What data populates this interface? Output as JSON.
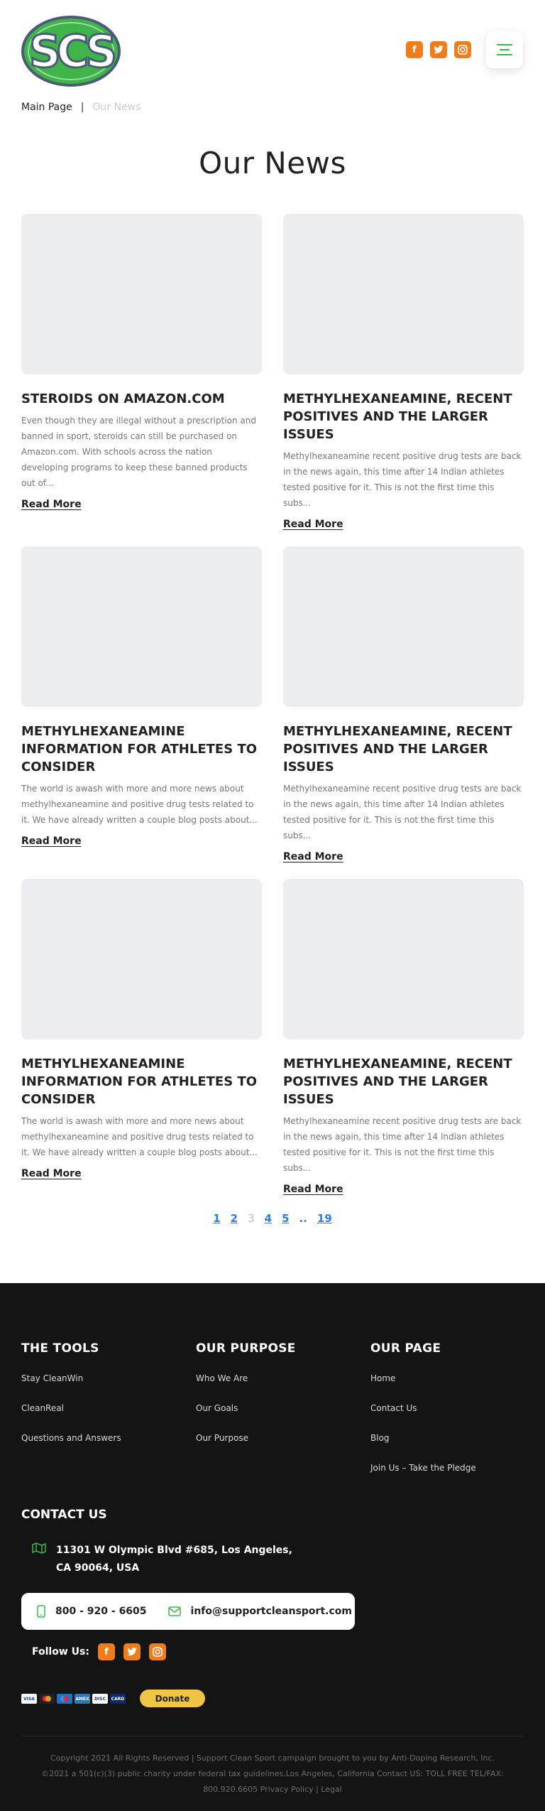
{
  "header": {
    "logo_text": "SCS",
    "social": [
      {
        "icon": "facebook-icon",
        "glyph": "f"
      },
      {
        "icon": "twitter-icon",
        "glyph": "t"
      },
      {
        "icon": "instagram-icon",
        "glyph": "◎"
      }
    ],
    "menu_icon": "hamburger-icon"
  },
  "breadcrumb": {
    "home": "Main Page",
    "separator": "|",
    "current": "Our News"
  },
  "page_title": "Our News",
  "read_more_label": "Read More",
  "posts": [
    {
      "title": "STEROIDS ON AMAZON.COM",
      "excerpt": "Even though they are illegal without a prescription and banned in sport, steroids can still be purchased on Amazon.com. With schools across the nation developing programs to keep these banned products out of..."
    },
    {
      "title": "METHYLHEXANEAMINE, RECENT POSITIVES AND THE LARGER ISSUES",
      "excerpt": "Methylhexaneamine recent positive drug tests are back in the news again, this time after 14 Indian athletes tested positive for it. This is not the first time this subs..."
    },
    {
      "title": "METHYLHEXANEAMINE INFORMATION FOR ATHLETES TO CONSIDER",
      "excerpt": "The world is awash with more and more news about methylhexaneamine and positive drug tests related to it.  We have already written a couple blog posts about..."
    },
    {
      "title": "METHYLHEXANEAMINE, RECENT POSITIVES AND THE LARGER ISSUES",
      "excerpt": "Methylhexaneamine recent positive drug tests are back in the news again, this time after 14 Indian athletes tested positive for it. This is not the first time this subs..."
    },
    {
      "title": "METHYLHEXANEAMINE INFORMATION FOR ATHLETES TO CONSIDER",
      "excerpt": "The world is awash with more and more news about methylhexaneamine and positive drug tests related to it.  We have already written a couple blog posts about..."
    },
    {
      "title": "METHYLHEXANEAMINE, RECENT POSITIVES AND THE LARGER ISSUES",
      "excerpt": "Methylhexaneamine recent positive drug tests are back in the news again, this time after 14 Indian athletes tested positive for it. This is not the first time this subs..."
    }
  ],
  "pagination": {
    "pages": [
      "1",
      "2",
      "3",
      "4",
      "5",
      "19"
    ],
    "current": "3",
    "ellipsis": ".."
  },
  "footer": {
    "tools": {
      "heading": "THE TOOLS",
      "items": [
        "Stay CleanWin",
        "CleanReal",
        "Questions and Answers"
      ]
    },
    "purpose": {
      "heading": "OUR PURPOSE",
      "items": [
        "Who We Are",
        "Our Goals",
        "Our Purpose"
      ]
    },
    "page": {
      "heading": "OUR PAGE",
      "items": [
        "Home",
        "Contact Us",
        "Blog",
        "Join Us – Take the Pledge"
      ]
    },
    "contact": {
      "heading": "CONTACT US",
      "address_line1": "11301 W Olympic Blvd #685, Los Angeles,",
      "address_line2": "CA 90064, USA",
      "phone": "800 - 920 - 6605",
      "email": "info@supportcleansport.com",
      "follow_label": "Follow Us:"
    },
    "payments": [
      "VISA",
      "MC",
      "MAE",
      "AMEX",
      "DISC",
      "CARD"
    ],
    "donate_label": "Donate",
    "copyright_1": "Copyright 2021 All Rights Reserved | Support Clean Sport campaign brought to you by Anti-Doping Research, Inc.",
    "copyright_2": "©2021 a 501(c)(3) public charity under federal tax guidelines.Los Angeles, California Contact US: TOLL FREE TEL/FAX:",
    "copyright_3": "800.920.6605 Privacy Policy | Legal"
  },
  "colors": {
    "accent_orange": "#f07d1c",
    "accent_green": "#3bb54a",
    "link_blue": "#2b7de9",
    "footer_bg": "#141414"
  }
}
